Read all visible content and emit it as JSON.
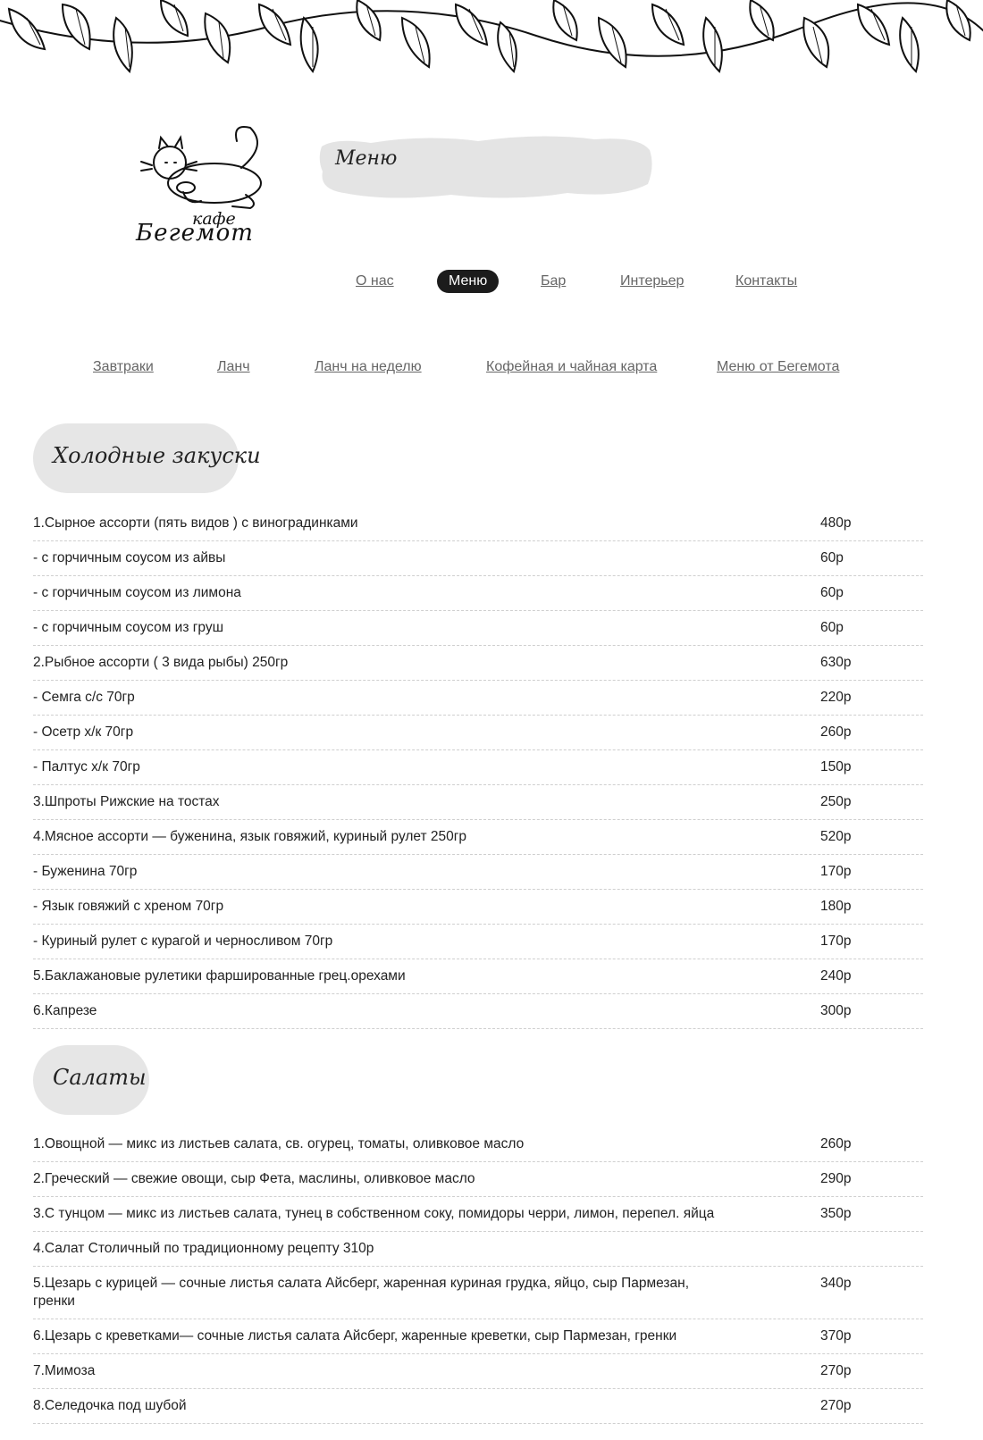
{
  "header": {
    "logo_small": "кафе",
    "logo_big": "Бегемот",
    "page_title": "Меню"
  },
  "main_nav": [
    {
      "label": "О нас",
      "active": false
    },
    {
      "label": "Меню",
      "active": true
    },
    {
      "label": "Бар",
      "active": false
    },
    {
      "label": "Интерьер",
      "active": false
    },
    {
      "label": "Контакты",
      "active": false
    }
  ],
  "sub_nav": [
    {
      "label": "Завтраки"
    },
    {
      "label": "Ланч"
    },
    {
      "label": "Ланч на неделю"
    },
    {
      "label": "Кофейная и чайная карта"
    },
    {
      "label": "Меню от Бегемота"
    }
  ],
  "sections": [
    {
      "title": "Холодные закуски",
      "items": [
        {
          "name": "1.Сырное ассорти (пять видов ) с виноградинками",
          "price": "480р"
        },
        {
          "name": "- с горчичным соусом из айвы",
          "price": "60р"
        },
        {
          "name": "- с горчичным соусом из лимона",
          "price": "60р"
        },
        {
          "name": "- с горчичным соусом из груш",
          "price": "60р"
        },
        {
          "name": "2.Рыбное ассорти ( 3 вида рыбы) 250гр",
          "price": "630р"
        },
        {
          "name": "- Семга с/с 70гр",
          "price": "220р"
        },
        {
          "name": "- Осетр х/к 70гр",
          "price": "260р"
        },
        {
          "name": "- Палтус х/к 70гр",
          "price": "150р"
        },
        {
          "name": "3.Шпроты Рижские на тостах",
          "price": "250р"
        },
        {
          "name": "4.Мясное ассорти — буженина, язык говяжий, куриный рулет 250гр",
          "price": "520р"
        },
        {
          "name": "- Буженина 70гр",
          "price": "170р"
        },
        {
          "name": "- Язык говяжий с хреном 70гр",
          "price": "180р"
        },
        {
          "name": "- Куриный рулет с курагой и черносливом 70гр",
          "price": "170р"
        },
        {
          "name": "5.Баклажановые рулетики фаршированные грец.орехами",
          "price": "240р"
        },
        {
          "name": "6.Капрезе",
          "price": "300р"
        }
      ]
    },
    {
      "title": "Салаты",
      "items": [
        {
          "name": "1.Овощной — микс из листьев салата, св. огурец, томаты, оливковое масло",
          "price": "260р"
        },
        {
          "name": "2.Греческий — свежие овощи, сыр Фета, маслины, оливковое масло",
          "price": "290р"
        },
        {
          "name": "3.С тунцом — микс из листьев салата, тунец в собственном соку, помидоры черри, лимон, перепел. яйца",
          "price": "350р"
        },
        {
          "name": "4.Салат Столичный по традиционному рецепту 310р",
          "price": ""
        },
        {
          "name": "5.Цезарь с курицей — сочные листья салата Айсберг, жаренная куриная грудка, яйцо, сыр Пармезан, гренки",
          "price": "340р"
        },
        {
          "name": "6.Цезарь с креветками— сочные листья салата Айсберг, жаренные креветки, сыр Пармезан, гренки",
          "price": "370р"
        },
        {
          "name": "7.Мимоза",
          "price": "270р"
        },
        {
          "name": "8.Селедочка под шубой",
          "price": "270р"
        }
      ]
    }
  ],
  "colors": {
    "active_nav_bg": "#1c1c1c",
    "pill_bg": "#e6e6e6",
    "link": "#666666"
  }
}
